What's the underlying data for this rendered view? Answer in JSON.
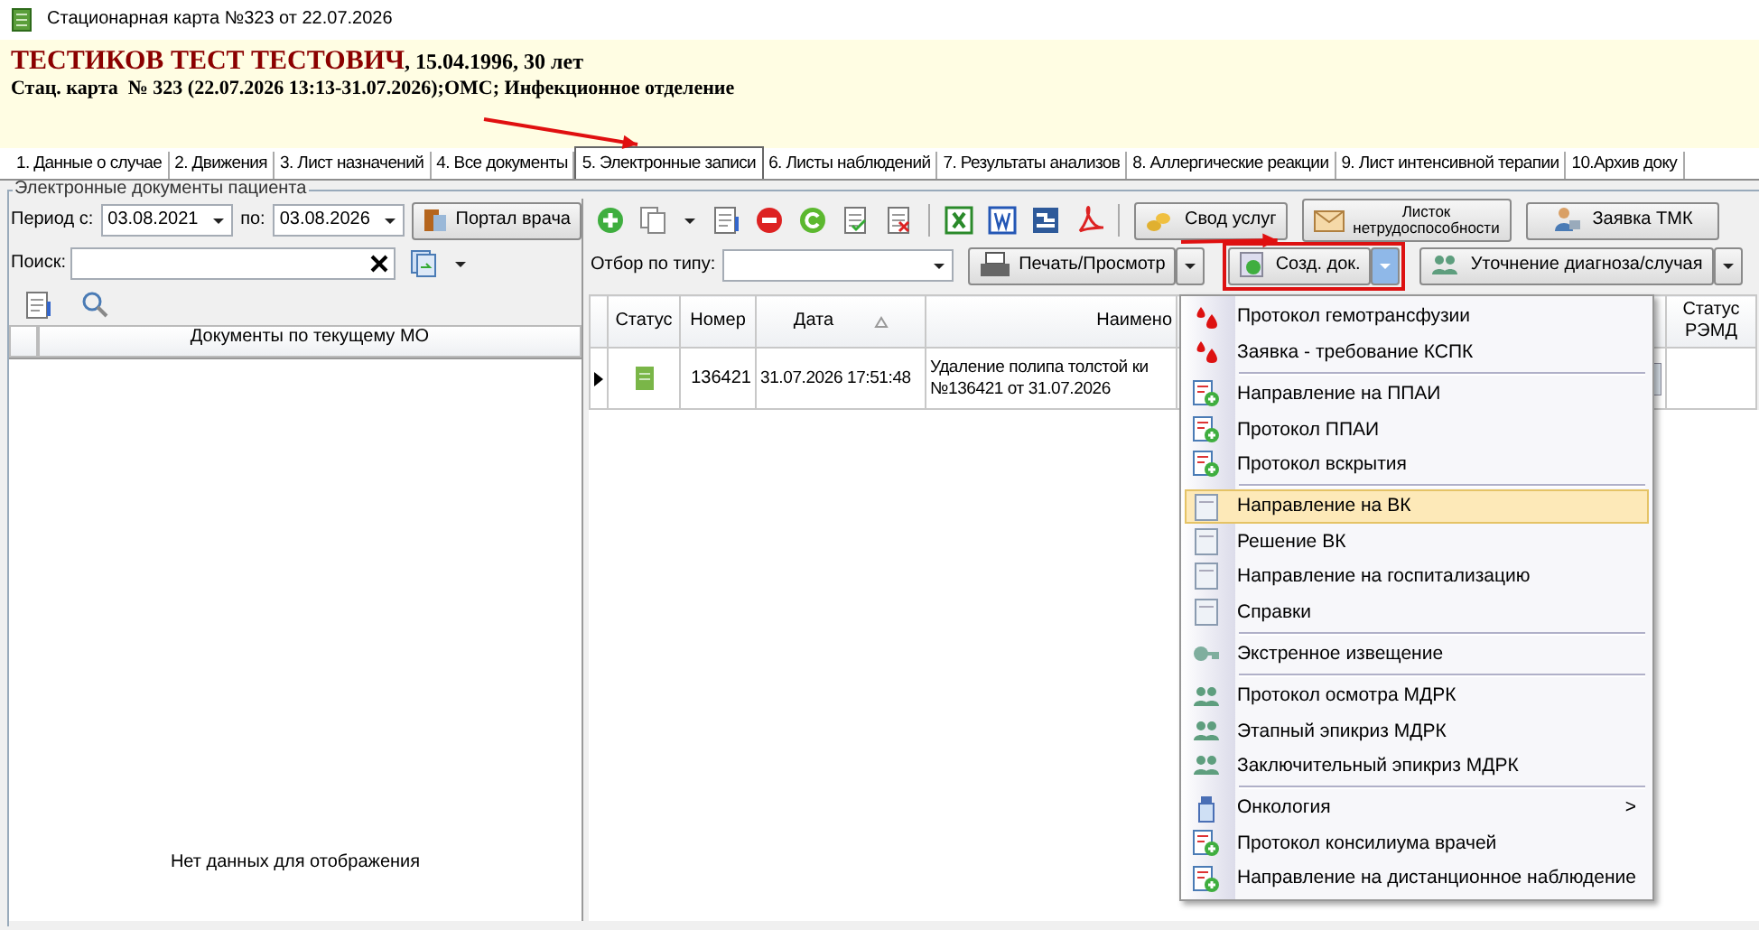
{
  "window": {
    "title": "Стационарная карта №323 от 22.07.2026"
  },
  "patient": {
    "name": "ТЕСТИКОВ ТЕСТ ТЕСТОВИЧ",
    "details": ", 15.04.1996, 30 лет",
    "card": "Стац. карта  № 323 (22.07.2026 13:13-31.07.2026);ОМС; Инфекционное отделение"
  },
  "tabs": [
    {
      "label": "1. Данные о случае",
      "selected": false
    },
    {
      "label": "2. Движения",
      "selected": false
    },
    {
      "label": "3. Лист назначений",
      "selected": false
    },
    {
      "label": "4. Все документы",
      "selected": false
    },
    {
      "label": "5. Электронные записи",
      "selected": true
    },
    {
      "label": "6. Листы наблюдений",
      "selected": false
    },
    {
      "label": "7. Результаты анализов",
      "selected": false
    },
    {
      "label": "8. Аллергические реакции",
      "selected": false
    },
    {
      "label": "9. Лист интенсивной терапии",
      "selected": false
    },
    {
      "label": "10.Архив доку",
      "selected": false
    }
  ],
  "group_title": "Электронные документы пациента",
  "left_panel": {
    "period_label": "Период с:",
    "date_from": "03.08.2021",
    "to_label": "по:",
    "date_to": "03.08.2026",
    "portal_button": "Портал врача",
    "search_label": "Поиск:",
    "table_column": "Документы по текущему МО",
    "empty_text": "Нет данных для отображения"
  },
  "right_panel": {
    "toolbar_buttons": [
      {
        "label": "Свод услуг",
        "kind": "coins"
      },
      {
        "label": "Листок нетрудоспособности",
        "kind": "envelope"
      },
      {
        "label": "Заявка ТМК",
        "kind": "user"
      }
    ],
    "filter_label": "Отбор по типу:",
    "print_button": "Печать/Просмотр",
    "create_button": {
      "label": "Созд. док.",
      "expanded": true
    },
    "refine_button": "Уточнение диагноза/случая",
    "table": {
      "columns": [
        "Статус",
        "Номер",
        "Дата",
        "Наимено",
        "",
        "Статус РЭМД"
      ],
      "rows": [
        {
          "selected": true,
          "number": "136421",
          "date": "31.07.2026 17:51:48",
          "name_lines": [
            "Удаление полипа толстой ки",
            "№136421 от 31.07.2026"
          ]
        }
      ]
    }
  },
  "menu": {
    "groups": [
      [
        {
          "label": "Протокол гемотрансфузии",
          "kind": "blood",
          "selected": false
        },
        {
          "label": "Заявка - требование КСПК",
          "kind": "blood",
          "selected": false
        }
      ],
      [
        {
          "label": "Направление на ППАИ",
          "kind": "protocol",
          "selected": false
        },
        {
          "label": "Протокол ППАИ",
          "kind": "protocol",
          "selected": false
        },
        {
          "label": "Протокол вскрытия",
          "kind": "protocol",
          "selected": false
        }
      ],
      [
        {
          "label": "Направление на ВК",
          "kind": "form",
          "selected": true
        },
        {
          "label": "Решение ВК",
          "kind": "form",
          "selected": false
        },
        {
          "label": "Направление на госпитализацию",
          "kind": "form",
          "selected": false
        },
        {
          "label": "Справки",
          "kind": "form",
          "selected": false
        }
      ],
      [
        {
          "label": "Экстренное извещение",
          "kind": "notice",
          "selected": false
        }
      ],
      [
        {
          "label": "Протокол осмотра МДРК",
          "kind": "commission",
          "selected": false
        },
        {
          "label": "Этапный эпикриз МДРК",
          "kind": "commission",
          "selected": false
        },
        {
          "label": "Заключительный эпикриз МДРК",
          "kind": "commission",
          "selected": false
        }
      ],
      [
        {
          "label": "Онкология",
          "kind": "oncology",
          "selected": false,
          "arrow": ">"
        },
        {
          "label": "Протокол консилиума врачей",
          "kind": "protocol",
          "selected": false
        },
        {
          "label": "Направление на дистанционное наблюдение",
          "kind": "protocol",
          "selected": false
        }
      ]
    ]
  }
}
